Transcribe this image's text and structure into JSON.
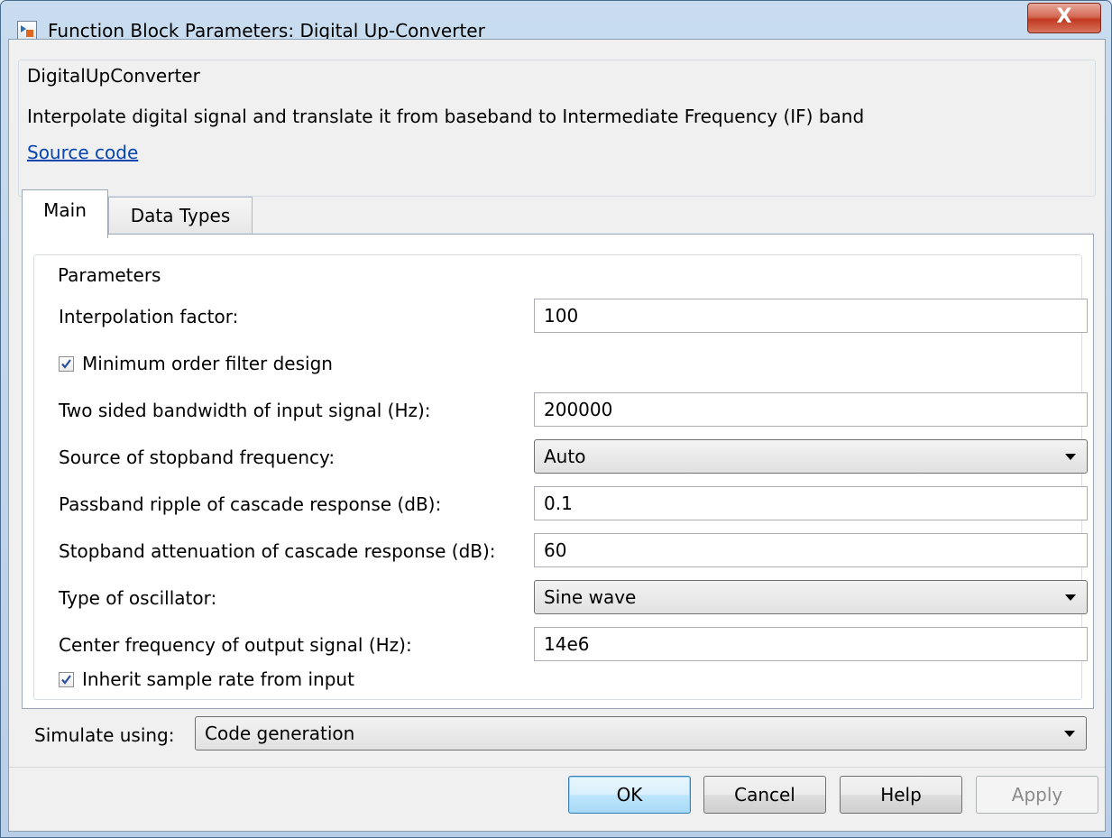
{
  "window": {
    "title": "Function Block Parameters: Digital Up-Converter",
    "close_glyph": "X"
  },
  "description": {
    "group_title": "DigitalUpConverter",
    "text": "Interpolate digital signal and translate it from baseband to Intermediate Frequency (IF) band",
    "source_link": "Source code"
  },
  "tabs": [
    {
      "label": "Main",
      "active": true
    },
    {
      "label": "Data Types",
      "active": false
    }
  ],
  "parameters": {
    "group_title": "Parameters",
    "interpolation_factor": {
      "label": "Interpolation factor:",
      "value": "100"
    },
    "min_order_filter": {
      "label": "Minimum order filter design",
      "checked": true
    },
    "bandwidth": {
      "label": "Two sided bandwidth of input signal (Hz):",
      "value": "200000"
    },
    "stopband_source": {
      "label": "Source of stopband frequency:",
      "value": "Auto"
    },
    "passband_ripple": {
      "label": "Passband ripple of cascade response (dB):",
      "value": "0.1"
    },
    "stopband_attenuation": {
      "label": "Stopband attenuation of cascade response (dB):",
      "value": "60"
    },
    "oscillator_type": {
      "label": "Type of oscillator:",
      "value": "Sine wave"
    },
    "center_frequency": {
      "label": "Center frequency of output signal (Hz):",
      "value": "14e6"
    },
    "inherit_sample_rate": {
      "label": "Inherit sample rate from input",
      "checked": true
    }
  },
  "simulate": {
    "label": "Simulate using:",
    "value": "Code generation"
  },
  "buttons": {
    "ok": "OK",
    "cancel": "Cancel",
    "help": "Help",
    "apply": "Apply"
  },
  "colors": {
    "link": "#0645ad",
    "close_button": "#c0391f",
    "default_button_border": "#3c7fb1"
  }
}
